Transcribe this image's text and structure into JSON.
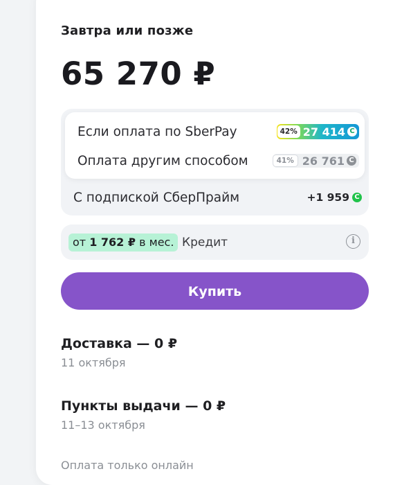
{
  "delivery": {
    "when_label": "Завтра или позже"
  },
  "price": {
    "total": "65 270 ₽"
  },
  "payment": {
    "sberpay": {
      "label": "Если оплата по SberPay",
      "percent": "42%",
      "amount": "27 414",
      "color": "#1fb6c9"
    },
    "other": {
      "label": "Оплата другим способом",
      "percent": "41%",
      "amount": "26 761"
    },
    "prime": {
      "label": "С подпиской СберПрайм",
      "amount": "+1 959"
    },
    "bonus_icon_letter": "С"
  },
  "credit": {
    "prefix": "от",
    "amount": "1 762 ₽",
    "suffix": "в мес.",
    "label": "Кредит",
    "badge_color": "#b7f2d6",
    "info_icon": "i"
  },
  "buy_button": {
    "label": "Купить",
    "color": "#8654c9"
  },
  "options": [
    {
      "title": "Доставка — 0 ₽",
      "subtitle": "11 октября"
    },
    {
      "title": "Пункты выдачи — 0 ₽",
      "subtitle": "11–13 октября"
    }
  ],
  "footer_note": "Оплата только онлайн"
}
